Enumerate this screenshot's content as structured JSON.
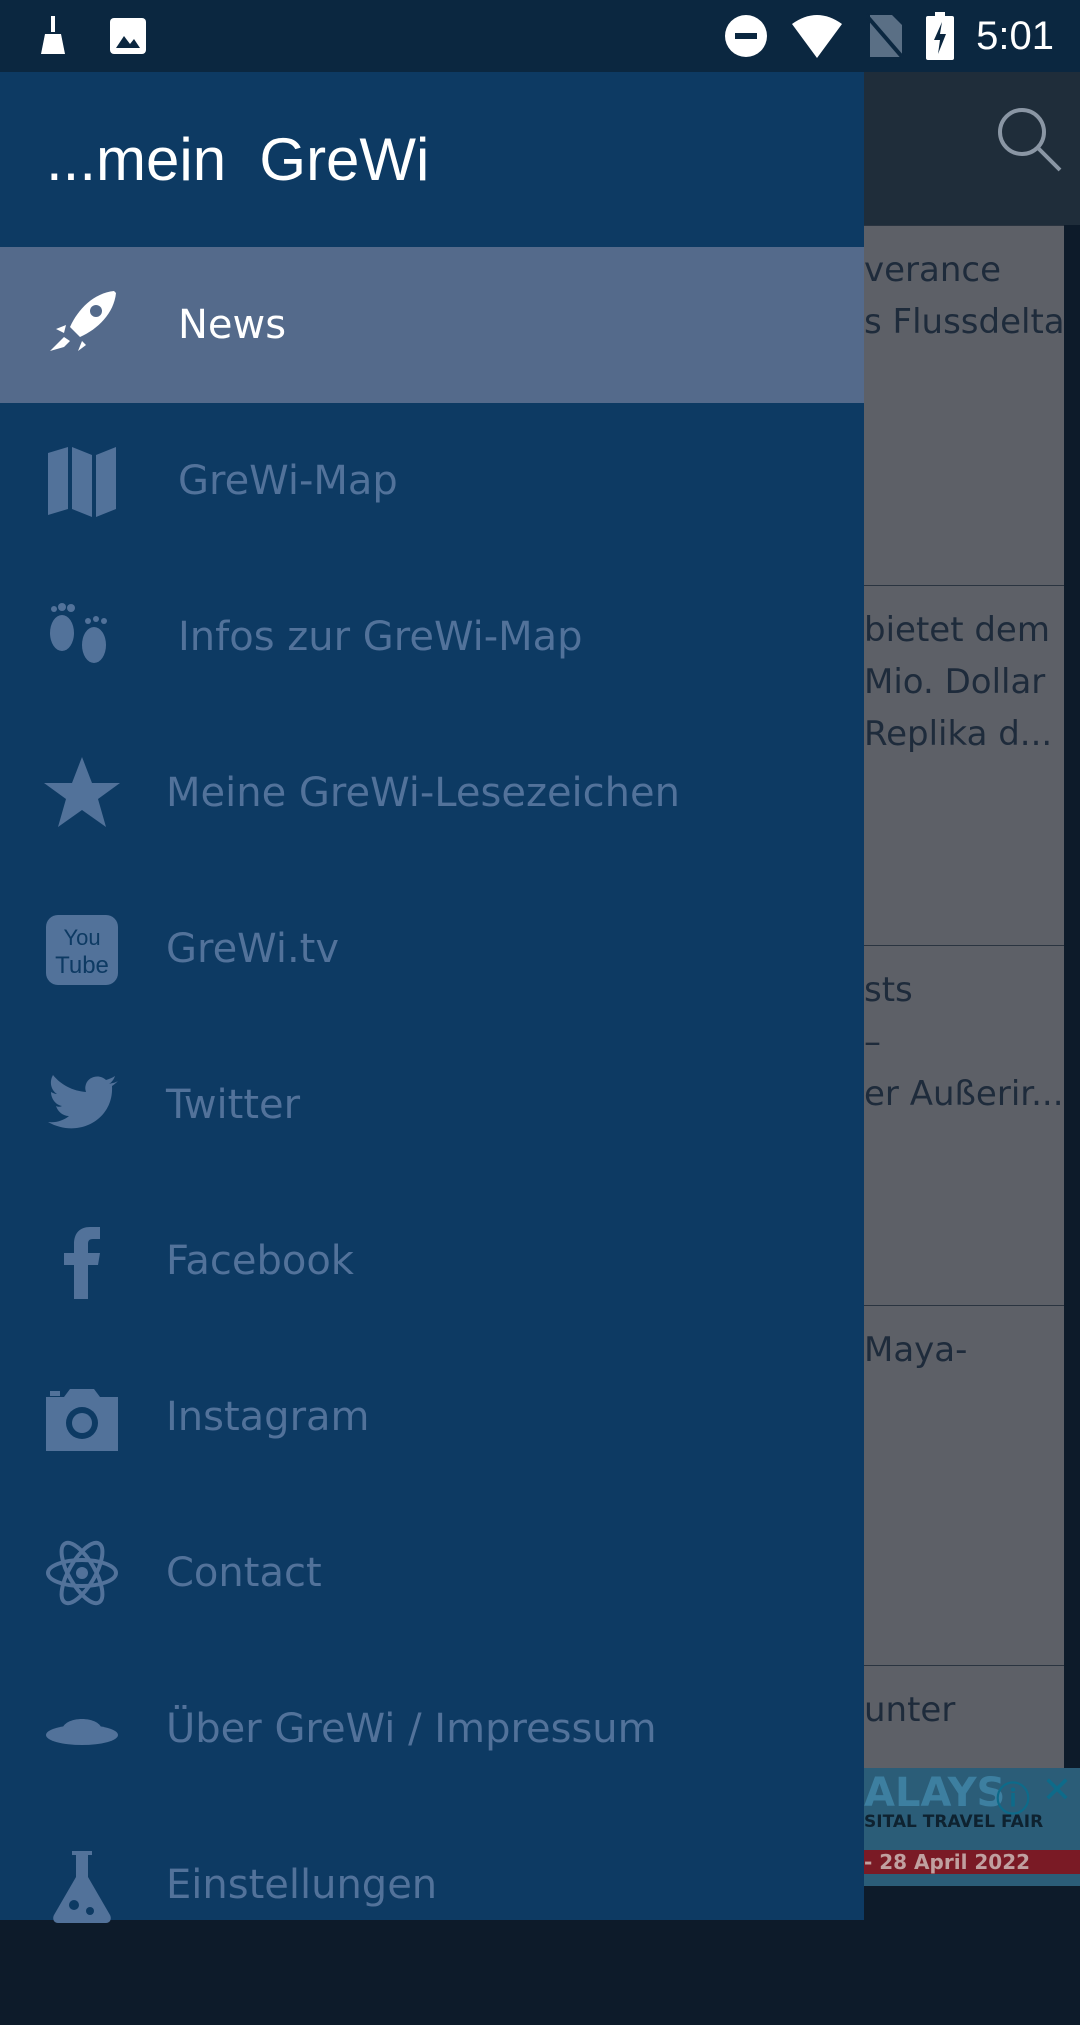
{
  "status_bar": {
    "time": "5:01",
    "icons": [
      "broom-icon",
      "image-icon",
      "dnd-icon",
      "wifi-icon",
      "no-sim-icon",
      "battery-charging-icon"
    ]
  },
  "drawer": {
    "title": "...mein  GreWi",
    "items": [
      {
        "label": "News",
        "icon": "rocket-icon",
        "selected": true
      },
      {
        "label": "GreWi-Map",
        "icon": "map-icon"
      },
      {
        "label": "Infos zur GreWi-Map",
        "icon": "footprints-icon"
      },
      {
        "label": "Meine GreWi-Lesezeichen",
        "icon": "star-icon"
      },
      {
        "label": "GreWi.tv",
        "icon": "youtube-icon"
      },
      {
        "label": "Twitter",
        "icon": "twitter-icon"
      },
      {
        "label": "Facebook",
        "icon": "facebook-icon"
      },
      {
        "label": "Instagram",
        "icon": "camera-icon"
      },
      {
        "label": "Contact",
        "icon": "atom-icon"
      },
      {
        "label": "Über GreWi / Impressum",
        "icon": "ufo-icon"
      },
      {
        "label": "Einstellungen",
        "icon": "flask-icon"
      }
    ]
  },
  "background": {
    "cards": [
      "verance\ns Flussdelta",
      "bietet dem\nMio. Dollar\nReplika d...",
      "sts\n–\ner Außerir...",
      "Maya-",
      "unter"
    ],
    "ad": {
      "line1": "ALAYS",
      "line2": "SITAL TRAVEL FAIR",
      "line3": "- 28 April 2022"
    }
  }
}
